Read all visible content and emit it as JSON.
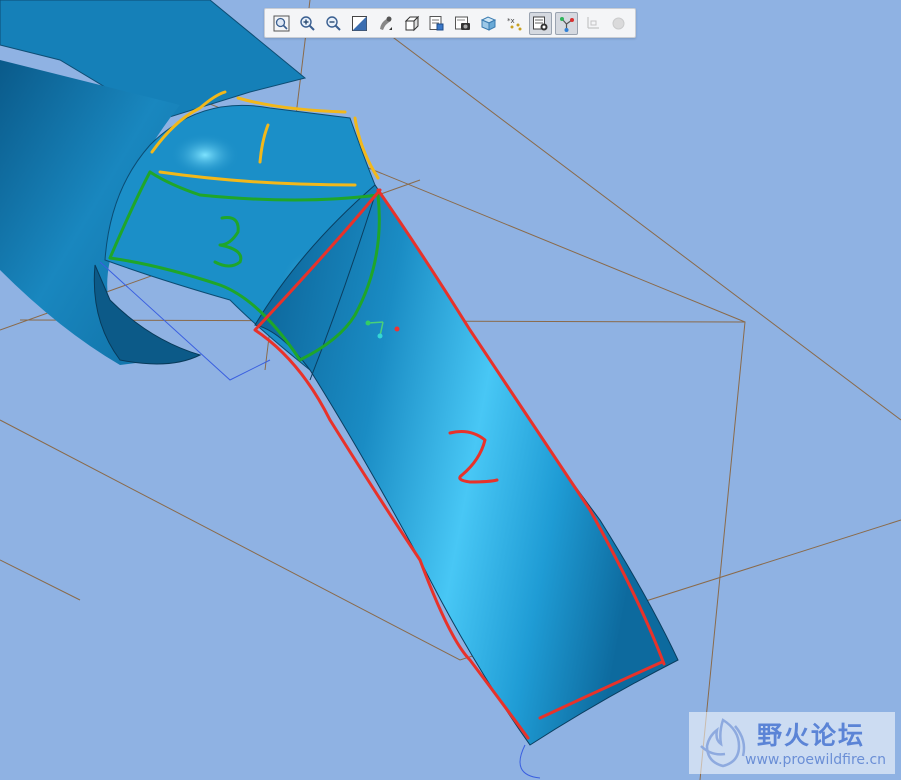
{
  "app": {
    "view": "3d-model-viewport"
  },
  "toolbar": {
    "buttons": [
      {
        "name": "refit-button",
        "icon": "refit-icon",
        "active": false
      },
      {
        "name": "zoom-in-button",
        "icon": "zoom-in-icon",
        "active": false
      },
      {
        "name": "zoom-out-button",
        "icon": "zoom-out-icon",
        "active": false
      },
      {
        "name": "repaint-button",
        "icon": "repaint-icon",
        "active": false
      },
      {
        "name": "display-style-button",
        "icon": "display-style-icon",
        "active": false
      },
      {
        "name": "saved-orientations-button",
        "icon": "cube-icon",
        "active": false
      },
      {
        "name": "view-manager-button",
        "icon": "view-manager-icon",
        "active": false
      },
      {
        "name": "section-button",
        "icon": "camera-icon",
        "active": false
      },
      {
        "name": "perspective-button",
        "icon": "box-icon",
        "active": false
      },
      {
        "name": "datum-display-button",
        "icon": "datum-points-icon",
        "active": false
      },
      {
        "name": "plane-display-button",
        "icon": "plane-display-icon",
        "active": true
      },
      {
        "name": "axis-display-button",
        "icon": "spin-center-icon",
        "active": true
      },
      {
        "name": "csys-display-button",
        "icon": "csys-icon",
        "active": false
      },
      {
        "name": "annotation-button",
        "icon": "circle-icon",
        "active": false
      }
    ]
  },
  "annotations": {
    "labels": [
      "1",
      "2",
      "3"
    ],
    "colors": {
      "yellow": "#f2b81a",
      "red": "#e8322a",
      "green": "#1fa62a"
    }
  },
  "model": {
    "surface_color": "#1a8cc4",
    "highlight_color": "#4fd3ff",
    "background_color": "#8fb2e3"
  },
  "watermark": {
    "title": "野火论坛",
    "url": "www.proewildfire.cn"
  }
}
